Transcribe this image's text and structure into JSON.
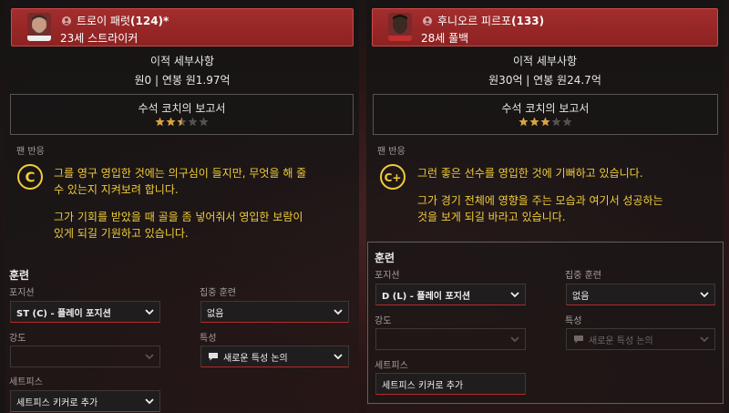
{
  "left": {
    "player": {
      "name": "트로이 패럿",
      "ca": "(124)*",
      "age_position": "23세 스트라이커",
      "avatar": "player-photo-avatar",
      "person_icon": "person-icon"
    },
    "transfer": {
      "title": "이적 세부사항",
      "value": "원0 | 연봉 원1.97억"
    },
    "report": {
      "title": "수석 코치의 보고서",
      "stars": 2.5,
      "max_stars": 5
    },
    "fan": {
      "label": "팬 반응",
      "grade": "C",
      "lines": [
        "그를 영구 영입한 것에는 의구심이 들지만, 무엇을 해 줄",
        "수 있는지 지켜보려 합니다.",
        "그가 기회를 받았을 때 골을 좀 넣어줘서 영입한 보람이",
        "있게 되길 기원하고 있습니다."
      ]
    },
    "training": {
      "title": "훈련",
      "position_label": "포지션",
      "position_value": "ST (C) - 플레이 포지션",
      "focus_label": "집중 훈련",
      "focus_value": "없음",
      "intensity_label": "강도",
      "intensity_value": "",
      "traits_label": "특성",
      "traits_value": "새로운 특성 논의",
      "setpiece_label": "세트피스",
      "setpiece_value": "세트피스 키커로 추가"
    }
  },
  "right": {
    "player": {
      "name": "후니오르 피르포",
      "ca": "(133)",
      "age_position": "28세 풀백",
      "avatar": "player-photo-avatar",
      "person_icon": "person-icon"
    },
    "transfer": {
      "title": "이적 세부사항",
      "value": "원30억 | 연봉 원24.7억"
    },
    "report": {
      "title": "수석 코치의 보고서",
      "stars": 3,
      "max_stars": 5
    },
    "fan": {
      "label": "팬 반응",
      "grade": "C+",
      "lines": [
        "그런 좋은 선수를 영입한 것에 기뻐하고 있습니다.",
        "그가 경기 전체에 영향을 주는 모습과 여기서 성공하는",
        "것을 보게 되길 바라고 있습니다."
      ]
    },
    "training": {
      "title": "훈련",
      "position_label": "포지션",
      "position_value": "D (L) - 플레이 포지션",
      "focus_label": "집중 훈련",
      "focus_value": "없음",
      "intensity_label": "강도",
      "intensity_value": "",
      "traits_label": "특성",
      "traits_value": "새로운 특성 논의",
      "setpiece_label": "세트피스",
      "setpiece_value": "세트피스 키커로 추가"
    }
  },
  "colors": {
    "header_red": "#a32d2d",
    "fan_yellow": "#f0cc3a",
    "star_gold": "#d9a441",
    "star_empty": "#555050",
    "dropdown_underline": "#b32b2b"
  }
}
